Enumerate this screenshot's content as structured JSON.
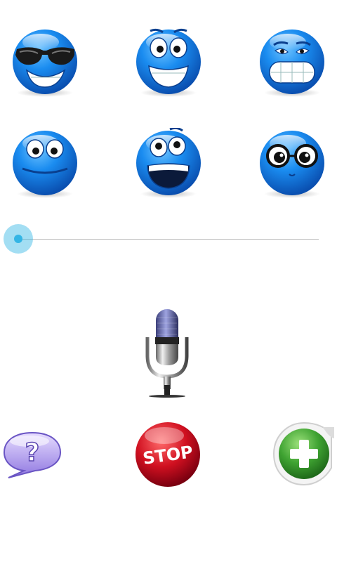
{
  "emoticons": [
    {
      "id": "cool-sunglasses"
    },
    {
      "id": "happy"
    },
    {
      "id": "grin"
    },
    {
      "id": "smile"
    },
    {
      "id": "scared"
    },
    {
      "id": "nerd-glasses"
    }
  ],
  "slider": {
    "value": 0.0
  },
  "controls": {
    "record_icon": "microphone-icon",
    "help_icon": "help-bubble-icon",
    "stop_label": "STOP",
    "add_icon": "add-sticker-icon"
  },
  "colors": {
    "accent": "#33b5e5",
    "emoji_blue": "#1e88e5",
    "stop_red": "#c8102e",
    "add_green": "#43a047"
  }
}
